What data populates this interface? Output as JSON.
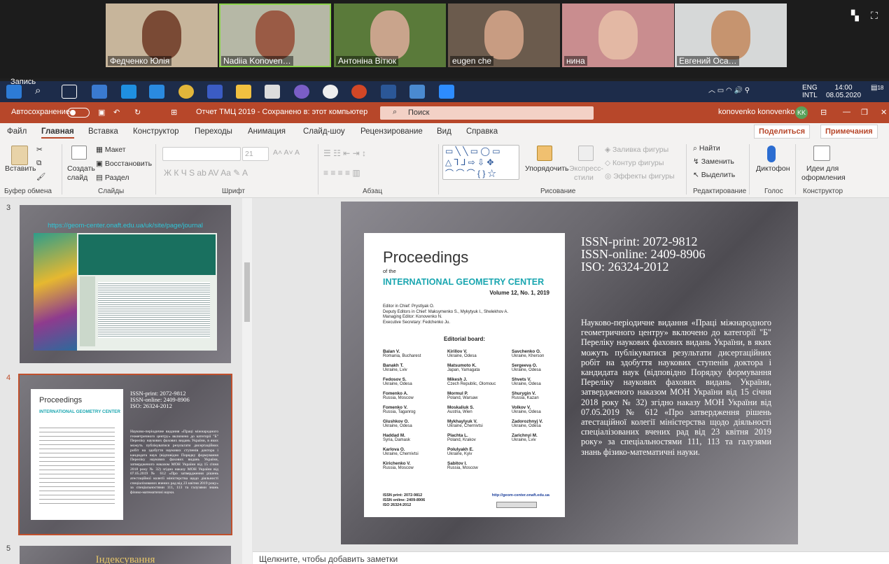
{
  "participants": [
    {
      "name": "Федченко Юлія",
      "bg": "#c7b59b",
      "face": "#7a4a35",
      "active": false
    },
    {
      "name": "Nadiia Konoven…",
      "bg": "#b6b8a6",
      "face": "#9a5b45",
      "active": true
    },
    {
      "name": "Антоніна Вітюк",
      "bg": "#5a7a3a",
      "face": "#c9a48c",
      "active": false
    },
    {
      "name": "eugen che",
      "bg": "#6b5b4d",
      "face": "#c89c82",
      "active": false
    },
    {
      "name": "нина",
      "bg": "#c98d8f",
      "face": "#e3b8a4",
      "active": false
    },
    {
      "name": "Евгений Оса…",
      "bg": "#d6d8d8",
      "face": "#c6946f",
      "active": false
    }
  ],
  "taskbar": {
    "recording": "Запись",
    "lang": "ENG",
    "lang2": "INTL",
    "time": "14:00",
    "date": "08.05.2020",
    "notif": "18"
  },
  "titlebar": {
    "autosave": "Автосохранение",
    "doc": "Отчет ТМЦ 2019 - Сохранено в: этот компьютер",
    "search": "Поиск",
    "user": "konovenko konovenko",
    "initials": "KK"
  },
  "tabs": [
    "Файл",
    "Главная",
    "Вставка",
    "Конструктор",
    "Переходы",
    "Анимация",
    "Слайд-шоу",
    "Рецензирование",
    "Вид",
    "Справка"
  ],
  "share": "Поделиться",
  "comments": "Примечания",
  "ribbon": {
    "paste": "Вставить",
    "clipboard": "Буфер обмена",
    "create": "Создать",
    "slide": "слайд",
    "layout": "Макет",
    "reset": "Восстановить",
    "section": "Раздел",
    "slides": "Слайды",
    "fontsize": "21",
    "font": "Шрифт",
    "paragraph": "Абзац",
    "arrange": "Упорядочить",
    "express": "Экспресс-",
    "styles": "стили",
    "fill": "Заливка фигуры",
    "outline": "Контур фигуры",
    "effects": "Эффекты фигуры",
    "drawing": "Рисование",
    "find": "Найти",
    "replace": "Заменить",
    "select": "Выделить",
    "editing": "Редактирование",
    "dictation": "Диктофон",
    "voice": "Голос",
    "ideas1": "Идеи для",
    "ideas2": "оформления",
    "designer": "Конструктор"
  },
  "slides_panel": {
    "n3": "3",
    "n4": "4",
    "n5": "5",
    "s3_link": "https://geom-center.onaft.edu.ua/uk/site/page/journal",
    "s5_title": "Індексування"
  },
  "journal": {
    "title": "Proceedings",
    "of": "of the",
    "center": "INTERNATIONAL GEOMETRY CENTER",
    "volume": "Volume 12, No. 1, 2019",
    "editors": [
      "Editor in Chief: Prystlyak O.",
      "Deputy Editors in Chief: Maksymenko S., Mykytyuk I., Shelekhov A.",
      "Managing Editor: Konovenko N.",
      "Executive Secretary: Fedchenko Ju."
    ],
    "board_title": "Editorial board:",
    "board": [
      {
        "n": "Balan V.",
        "c": "Romania, Bucharest"
      },
      {
        "n": "Kirillov V.",
        "c": "Ukraine, Odesa"
      },
      {
        "n": "Savchenko O.",
        "c": "Ukraine, Kherson"
      },
      {
        "n": "Banakh T.",
        "c": "Ukraine, Lviv"
      },
      {
        "n": "Matsumoto K.",
        "c": "Japan, Yamagata"
      },
      {
        "n": "Sergeeva O.",
        "c": "Ukraine, Odesa"
      },
      {
        "n": "Fedosov S.",
        "c": "Ukraine, Odesa"
      },
      {
        "n": "Mikesh J.",
        "c": "Czech Republic, Olomouc"
      },
      {
        "n": "Shvets V.",
        "c": "Ukraine, Odesa"
      },
      {
        "n": "Fomenko A.",
        "c": "Russia, Moscow"
      },
      {
        "n": "Mormul P.",
        "c": "Poland, Warsaw"
      },
      {
        "n": "Shurygin V.",
        "c": "Russia, Kazan"
      },
      {
        "n": "Fomenko V.",
        "c": "Russia, Taganrog"
      },
      {
        "n": "Moskaliuk S.",
        "c": "Austria, Wien"
      },
      {
        "n": "Volkov V.",
        "c": "Ukraine, Odesa"
      },
      {
        "n": "Glushkov O.",
        "c": "Ukraine, Odesa"
      },
      {
        "n": "Mykhaylyuk V.",
        "c": "Ukraine, Chernivtsi"
      },
      {
        "n": "Zadorozhnyj V.",
        "c": "Ukraine, Odesa"
      },
      {
        "n": "Haddad M.",
        "c": "Syria, Damask"
      },
      {
        "n": "Plachta L.",
        "c": "Poland, Krakov"
      },
      {
        "n": "Zarichnyi M.",
        "c": "Ukraine, Lviv"
      },
      {
        "n": "Karlova O.",
        "c": "Ukraine, Chernivtsi"
      },
      {
        "n": "Polulyakh E.",
        "c": "Ukraine, Kyiv"
      },
      {
        "n": "",
        "c": ""
      },
      {
        "n": "Kirichenko V.",
        "c": "Russia, Moscow"
      },
      {
        "n": "Sabitov I.",
        "c": "Russia, Moscow"
      },
      {
        "n": "",
        "c": ""
      }
    ],
    "foot": [
      "ISSN print: 2072-9812",
      "ISSN online: 2409-8906",
      "ISO 26324:2012"
    ],
    "url": "http://geom-center.onaft.edu.ua"
  },
  "slide": {
    "issn": [
      "ISSN-print: 2072-9812",
      "ISSN-online: 2409-8906",
      "ISO: 26324-2012"
    ],
    "body": "Науково-періодичне видання «Праці міжнародного геометричного центру» включено до категорії \"Б\" Переліку наукових фахових видань України, в яких можуть публікуватися результати дисертаційних робіт на здобуття наукових ступенів доктора і кандидата наук (відповідно Порядку формування Переліку наукових фахових видань України, затвердженого наказом МОН України від 15 січня 2018 року № 32) згідно наказу МОН України від 07.05.2019 № 612 «Про затвердження рішень атестаційної колегії міністерства щодо діяльності спеціалізованих вчених рад від 23 квітня 2019 року» за спеціальностями 111, 113 та галузями знань фізико-математичні науки."
  },
  "notes": "Щелкните, чтобы добавить заметки",
  "colors": {
    "accent": "#b7472a",
    "taskbar": "#1d2c4a",
    "teal": "#1aa6b0"
  }
}
